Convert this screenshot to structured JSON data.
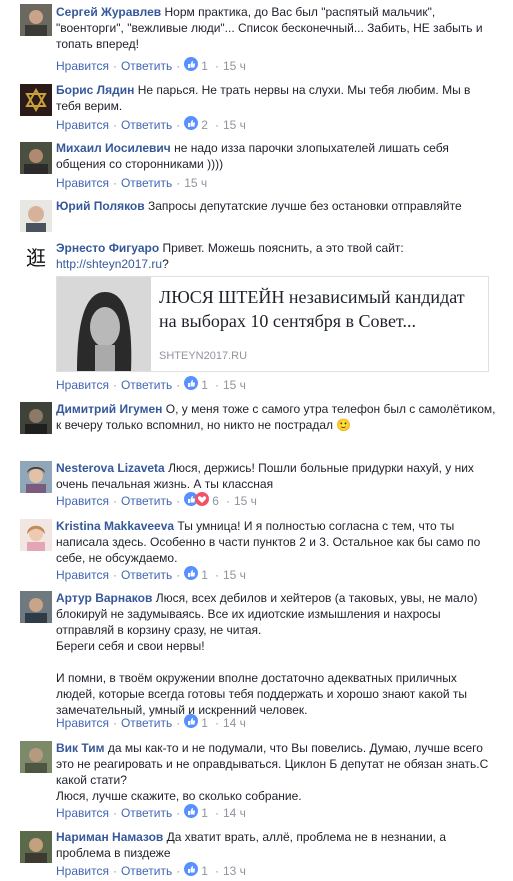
{
  "actions": {
    "like": "Нравится",
    "reply": "Ответить",
    "dot": "·"
  },
  "comments": [
    {
      "name": "Сергей Журавлев",
      "text": "Норм практика, до Вас был \"распятый мальчик\", \"военторги\", \"вежливые люди\"... Список бесконечный... Забить, НЕ забыть и топать вперед!",
      "likes": "1",
      "time": "15 ч"
    },
    {
      "name": "Борис Лядин",
      "text": "Не парься. Не трать нервы на слухи. Мы тебя любим. Мы в тебя верим.",
      "likes": "2",
      "time": "15 ч"
    },
    {
      "name": "Михаил Иосилевич",
      "text": "не надо изза парочки злопыхателей лишать себя общения со сторонниками ))))",
      "time": "15 ч"
    },
    {
      "name": "Юрий Поляков",
      "text": "Запросы депутатские лучше без остановки отправляйте"
    },
    {
      "name": "Эрнесто Фигуаро",
      "text": "Привет. Можешь пояснить, а это твой сайт:",
      "link": "http://shteyn2017.ru",
      "link_suffix": "?",
      "likes": "1",
      "time": "15 ч",
      "preview": {
        "title": "ЛЮСЯ ШТЕЙН независимый кандидат на выборах 10 сентября в Совет...",
        "domain": "SHTEYN2017.RU"
      }
    },
    {
      "name": "Димитрий Игумен",
      "text": "О, у меня тоже с самого утра телефон был с самолётиком, к вечеру только вспомнил, но никто не пострадал",
      "emoji": "🙂"
    },
    {
      "name": "Nesterova Lizaveta",
      "text": "Люся, держись! Пошли больные придурки нахуй, у них очень печальная жизнь. А ты классная",
      "likes": "6",
      "time": "15 ч"
    },
    {
      "name": "Kristina Makkaveeva",
      "text": "Ты умница! И я полностью согласна с тем, что ты написала здесь. Особенно в части пунктов 2 и 3. Остальное как бы само по себе, не обсуждаемо.",
      "likes": "1",
      "time": "15 ч"
    },
    {
      "name": "Артур Варнаков",
      "text": "Люся, всех дебилов и хейтеров (а таковых, увы, не мало) блокируй не задумываясь. Все их идиотские измышления и нахросы отправляй в корзину сразу, не читая.",
      "text2": "Береги себя и свои нервы!",
      "text3": "И помни, в твоём окружении вполне достаточно адекватных приличных людей, которые всегда готовы тебя поддержать и хорошо знают какой ты замечательный, умный и искренний человек.",
      "likes": "1",
      "time": "14 ч"
    },
    {
      "name": "Вик Тим",
      "text": "да мы как-то и не подумали, что Вы повелись. Думаю, лучше всего это не реагировать и не оправдываться. Циклон Б депутат не обязан знать.С какой стати?",
      "text2": "Люся, лучше скажите, во сколько собрание.",
      "likes": "1",
      "time": "14 ч"
    },
    {
      "name": "Нариман Намазов",
      "text": "Да хватит врать, аллё, проблема не в незнании, а проблема в пиздеже",
      "likes": "1",
      "time": "13 ч"
    }
  ],
  "colors": {
    "name": "#365899",
    "link_action": "#4267b2",
    "meta": "#90949c",
    "like_blue": "#5890ff",
    "love_red": "#f25268"
  }
}
